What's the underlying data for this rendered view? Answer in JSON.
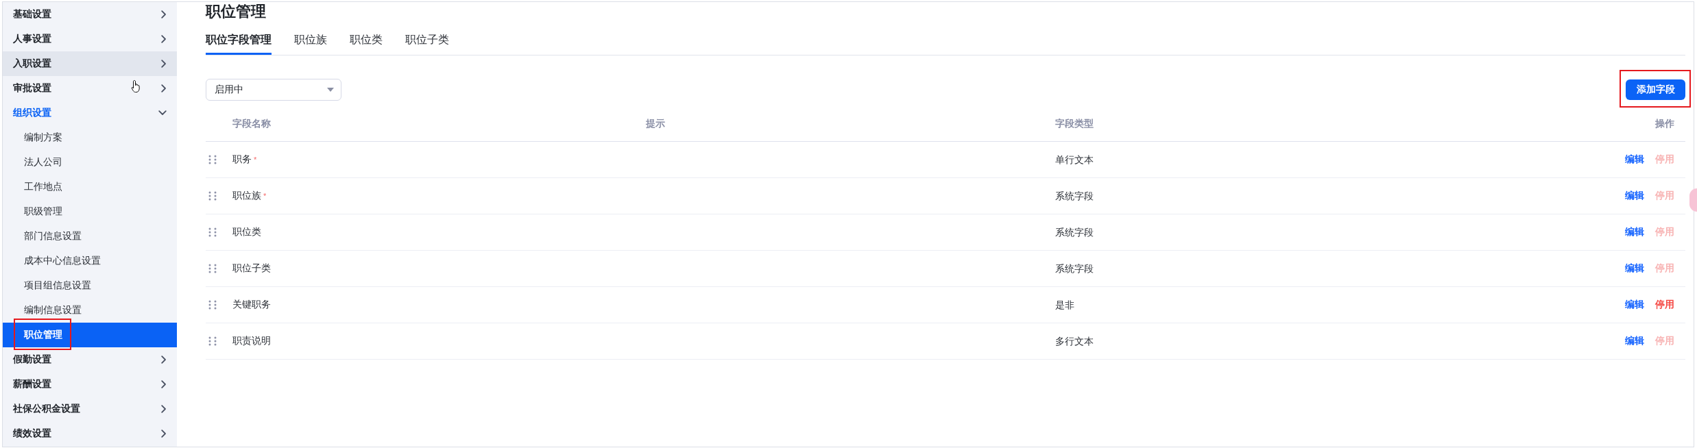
{
  "sidebar": {
    "items": [
      {
        "label": "基础设置",
        "expanded": false,
        "hovered": false
      },
      {
        "label": "人事设置",
        "expanded": false,
        "hovered": false
      },
      {
        "label": "入职设置",
        "expanded": false,
        "hovered": true
      },
      {
        "label": "审批设置",
        "expanded": false,
        "hovered": false
      },
      {
        "label": "组织设置",
        "expanded": true,
        "hovered": false,
        "children": [
          {
            "label": "编制方案",
            "selected": false,
            "highlighted": false
          },
          {
            "label": "法人公司",
            "selected": false,
            "highlighted": false
          },
          {
            "label": "工作地点",
            "selected": false,
            "highlighted": false
          },
          {
            "label": "职级管理",
            "selected": false,
            "highlighted": false
          },
          {
            "label": "部门信息设置",
            "selected": false,
            "highlighted": false
          },
          {
            "label": "成本中心信息设置",
            "selected": false,
            "highlighted": false
          },
          {
            "label": "项目组信息设置",
            "selected": false,
            "highlighted": false
          },
          {
            "label": "编制信息设置",
            "selected": false,
            "highlighted": false
          },
          {
            "label": "职位管理",
            "selected": true,
            "highlighted": true
          }
        ]
      },
      {
        "label": "假勤设置",
        "expanded": false,
        "hovered": false
      },
      {
        "label": "薪酬设置",
        "expanded": false,
        "hovered": false
      },
      {
        "label": "社保公积金设置",
        "expanded": false,
        "hovered": false
      },
      {
        "label": "绩效设置",
        "expanded": false,
        "hovered": false
      }
    ]
  },
  "page": {
    "title": "职位管理",
    "tabs": [
      {
        "label": "职位字段管理",
        "selected": true
      },
      {
        "label": "职位族",
        "selected": false
      },
      {
        "label": "职位类",
        "selected": false
      },
      {
        "label": "职位子类",
        "selected": false
      }
    ],
    "filter": {
      "value": "启用中"
    },
    "add_button": {
      "label": "添加字段",
      "highlighted": true
    },
    "table": {
      "columns": [
        "字段名称",
        "提示",
        "字段类型",
        "操作"
      ],
      "rows": [
        {
          "name": "职务",
          "mark": "*",
          "type": "单行文本",
          "actions": [
            {
              "label": "编辑",
              "kind": "edit",
              "disabled": false
            },
            {
              "label": "停用",
              "kind": "deactivate",
              "disabled": true
            }
          ]
        },
        {
          "name": "职位族",
          "mark": "*",
          "type": "系统字段",
          "actions": [
            {
              "label": "编辑",
              "kind": "edit",
              "disabled": false
            },
            {
              "label": "停用",
              "kind": "deactivate",
              "disabled": true
            }
          ]
        },
        {
          "name": "职位类",
          "type": "系统字段",
          "actions": [
            {
              "label": "编辑",
              "kind": "edit",
              "disabled": false
            },
            {
              "label": "停用",
              "kind": "deactivate",
              "disabled": true
            }
          ]
        },
        {
          "name": "职位子类",
          "type": "系统字段",
          "actions": [
            {
              "label": "编辑",
              "kind": "edit",
              "disabled": false
            },
            {
              "label": "停用",
              "kind": "deactivate",
              "disabled": true
            }
          ]
        },
        {
          "name": "关键职务",
          "type": "是非",
          "actions": [
            {
              "label": "编辑",
              "kind": "edit",
              "disabled": false
            },
            {
              "label": "停用",
              "kind": "deactivate",
              "disabled": false
            }
          ]
        },
        {
          "name": "职责说明",
          "type": "多行文本",
          "actions": [
            {
              "label": "编辑",
              "kind": "edit",
              "disabled": false
            },
            {
              "label": "停用",
              "kind": "deactivate",
              "disabled": true
            }
          ]
        }
      ]
    }
  }
}
